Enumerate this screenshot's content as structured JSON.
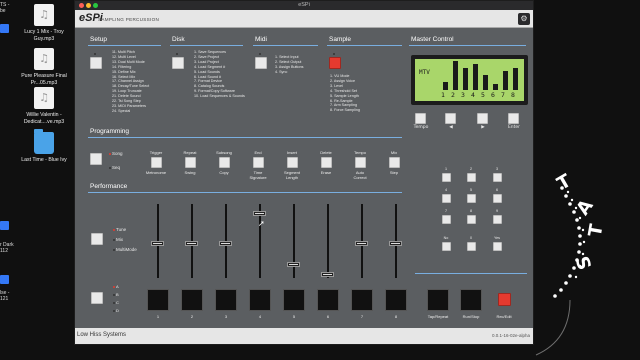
{
  "desktop": {
    "edge_top": "TS -\nbe",
    "items": [
      {
        "name": "Lucy 1 Mix - Troy Guy.mp3",
        "kind": "file"
      },
      {
        "name": "Pure Pleasure Final Pr...05.mp3",
        "kind": "file"
      },
      {
        "name": "Willie Valentin - Dedicat....ve.mp3",
        "kind": "file"
      },
      {
        "name": "Last Time - Blue Ivy",
        "kind": "folder"
      }
    ],
    "edge_mid": "r Dark\n112",
    "edge_bot": "lse -\n121",
    "deco_letters": [
      "T",
      "A",
      "T",
      "S"
    ]
  },
  "window": {
    "title": "eSPi",
    "app_name": "eSPi",
    "app_subtitle": "SAMPLING PERCUSSION",
    "settings_icon": "gear-icon",
    "accent": "#79aee0",
    "sections": {
      "setup": {
        "title": "Setup",
        "items": [
          "11. Multi Pitch",
          "12. Multi Level",
          "13. Dual Multi Mode",
          "14. Filtering",
          "15. Define Mix",
          "16. Select Mix",
          "17. Channel Assign",
          "18. Decay/Tune Select",
          "19. Loop Truncate",
          "21. Delete Sound",
          "22. Tsi Song Step",
          "23. MIDI Parameters",
          "24. Special"
        ]
      },
      "disk": {
        "title": "Disk",
        "items": [
          "1. Save Sequences",
          "2. Save Project",
          "3. Load Project",
          "4. Load Segment #",
          "5. Load Sounds",
          "6. Load Sound #",
          "7. Format Device",
          "8. Catalog Sounds",
          "9. Format/Copy Software",
          "10. Load Sequences & Sounds"
        ]
      },
      "midi": {
        "title": "Midi",
        "items": [
          "1. Select Input",
          "2. Select Output",
          "3. Assign Buttons",
          "4. Sync"
        ]
      },
      "sample": {
        "title": "Sample",
        "items": [
          "1. VU Mode",
          "2. Assign Voice",
          "3. Level",
          "4. Threshold Set",
          "5. Sample Length",
          "6. Re-Sample",
          "7. Arm Sampling",
          "8. Force Sampling"
        ]
      },
      "master": {
        "title": "Master Control",
        "lcd_label": "MTV",
        "lcd_numbers": [
          "1",
          "2",
          "3",
          "4",
          "5",
          "6",
          "7",
          "8"
        ],
        "lcd_levels": [
          0.2,
          0.95,
          0.7,
          0.85,
          0.45,
          0.15,
          0.6,
          0.7
        ],
        "nav_buttons": [
          "Tempo",
          "◀",
          "▶",
          "Enter"
        ],
        "keypad": [
          "1",
          "2",
          "3",
          "4",
          "5",
          "6",
          "7",
          "8",
          "9",
          "No",
          "0",
          "Yes"
        ]
      },
      "programming": {
        "title": "Programming",
        "mode_labels": [
          "Song",
          "Seq"
        ],
        "buttons": [
          {
            "top": "Trigger",
            "bottom": "Metronome"
          },
          {
            "top": "Repeat",
            "bottom": "Swing"
          },
          {
            "top": "Subsong",
            "bottom": "Copy"
          },
          {
            "top": "End",
            "bottom": "Time\nSignature"
          },
          {
            "top": "Insert",
            "bottom": "Segment\nLength"
          },
          {
            "top": "Delete",
            "bottom": "Erase"
          },
          {
            "top": "Tempo",
            "bottom": "Auto\nCorrect"
          },
          {
            "top": "Mix",
            "bottom": "Step"
          }
        ]
      },
      "performance": {
        "title": "Performance",
        "mode_labels": [
          "Tune",
          "Mix",
          "MultiMode"
        ],
        "bank_labels": [
          "A",
          "B",
          "C",
          "D"
        ],
        "fader_levels": [
          0.45,
          0.45,
          0.45,
          0.9,
          0.15,
          0.0,
          0.45,
          0.45
        ],
        "pad_numbers": [
          "1",
          "2",
          "3",
          "4",
          "5",
          "6",
          "7",
          "8"
        ],
        "transport": [
          "Tap/Repeat",
          "Run/Stop",
          "Rec/Edit"
        ]
      }
    },
    "footer": {
      "company": "Low Hiss Systems",
      "version": "0.0.1-16-02e-alpha"
    }
  }
}
